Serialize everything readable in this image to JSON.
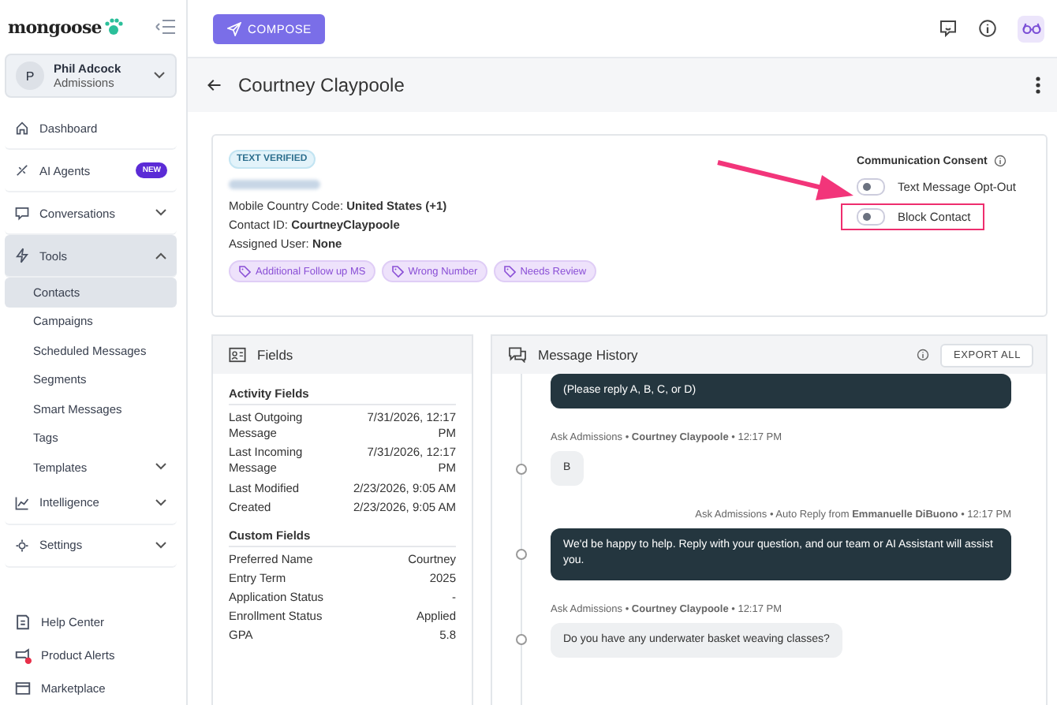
{
  "sidebar": {
    "logo": "mongoose",
    "user": {
      "initial": "P",
      "name": "Phil Adcock",
      "role": "Admissions"
    },
    "nav": [
      {
        "label": "Dashboard",
        "selected": false
      },
      {
        "label": "AI Agents",
        "selected": false,
        "badge": "NEW"
      },
      {
        "label": "Conversations",
        "selected": false,
        "expanded": false
      },
      {
        "label": "Tools",
        "selected": true,
        "expanded": true,
        "children": [
          {
            "label": "Contacts",
            "selected": true
          },
          {
            "label": "Campaigns",
            "selected": false
          },
          {
            "label": "Scheduled Messages",
            "selected": false
          },
          {
            "label": "Segments",
            "selected": false
          },
          {
            "label": "Smart Messages",
            "selected": false
          },
          {
            "label": "Tags",
            "selected": false
          },
          {
            "label": "Templates",
            "selected": false,
            "expanded": false
          }
        ]
      },
      {
        "label": "Intelligence",
        "selected": false,
        "expanded": false
      },
      {
        "label": "Settings",
        "selected": false,
        "expanded": false
      }
    ],
    "bottom": [
      {
        "label": "Help Center",
        "alert": false
      },
      {
        "label": "Product Alerts",
        "alert": true
      },
      {
        "label": "Marketplace",
        "alert": false
      }
    ]
  },
  "topbar": {
    "compose": "COMPOSE"
  },
  "header": {
    "title": "Courtney Claypoole"
  },
  "contact": {
    "verified": "TEXT VERIFIED",
    "details": [
      "Mobile Country Code: **United States (+1)**",
      "Contact ID: **CourtneyClaypoole**",
      "Assigned User: **None**"
    ],
    "tags": [
      "Additional Follow up MS",
      "Wrong Number",
      "Needs Review"
    ],
    "consent": {
      "title": "Communication Consent",
      "toggles": [
        {
          "label": "Text Message Opt-Out",
          "on": false
        },
        {
          "label": "Block Contact",
          "on": false,
          "highlighted": true
        }
      ]
    }
  },
  "fields": {
    "title": "Fields",
    "sections": [
      {
        "title": "Activity Fields",
        "rows": [
          {
            "label": "Last Outgoing Message",
            "value": "7/31/2026, 12:17 PM"
          },
          {
            "label": "Last Incoming Message",
            "value": "7/31/2026, 12:17 PM"
          },
          {
            "label": "Last Modified",
            "value": "2/23/2026, 9:05 AM"
          },
          {
            "label": "Created",
            "value": "2/23/2026, 9:05 AM"
          }
        ]
      },
      {
        "title": "Custom Fields",
        "rows": [
          {
            "label": "Preferred Name",
            "value": "Courtney"
          },
          {
            "label": "Entry Term",
            "value": "2025"
          },
          {
            "label": "Application Status",
            "value": "-"
          },
          {
            "label": "Enrollment Status",
            "value": "Applied"
          },
          {
            "label": "GPA",
            "value": "5.8"
          }
        ]
      }
    ]
  },
  "history": {
    "title": "Message History",
    "export": "EXPORT ALL",
    "messages": [
      {
        "kind": "outgoing",
        "text": "(Please reply A, B, C, or D)"
      },
      {
        "kind": "incoming",
        "meta": "Ask Admissions • **Courtney Claypoole** • 12:17 PM",
        "text": "B"
      },
      {
        "kind": "outgoing",
        "meta": "Ask Admissions • Auto Reply from **Emmanuelle DiBuono** • 12:17 PM",
        "text": "We'd be happy to help. Reply with your question, and our team or AI Assistant will assist you."
      },
      {
        "kind": "incoming",
        "meta": "Ask Admissions • **Courtney Claypoole** • 12:17 PM",
        "text": "Do you have any underwater basket weaving classes?"
      }
    ]
  }
}
